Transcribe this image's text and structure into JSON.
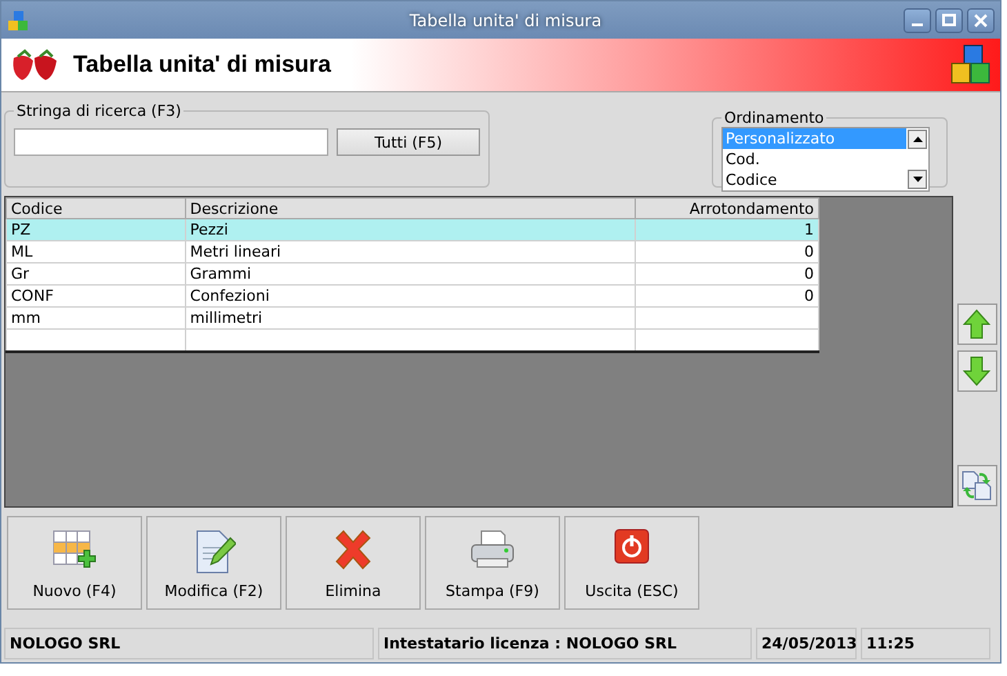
{
  "window": {
    "title": "Tabella unita' di misura"
  },
  "banner": {
    "title": "Tabella unita' di misura"
  },
  "search": {
    "label": "Stringa di ricerca (F3)",
    "button": "Tutti (F5)"
  },
  "ordering": {
    "label": "Ordinamento",
    "items": [
      {
        "label": "Personalizzato",
        "selected": true
      },
      {
        "label": "Cod.",
        "selected": false
      },
      {
        "label": "Codice",
        "selected": false
      }
    ]
  },
  "table": {
    "columns": [
      "Codice",
      "Descrizione",
      "Arrotondamento"
    ],
    "rows": [
      {
        "cells": [
          "PZ",
          "Pezzi",
          "1"
        ],
        "selected": true
      },
      {
        "cells": [
          "ML",
          "Metri lineari",
          "0"
        ],
        "selected": false
      },
      {
        "cells": [
          "Gr",
          "Grammi",
          "0"
        ],
        "selected": false
      },
      {
        "cells": [
          "CONF",
          "Confezioni",
          "0"
        ],
        "selected": false
      },
      {
        "cells": [
          "mm",
          "millimetri",
          ""
        ],
        "selected": false
      },
      {
        "cells": [
          "",
          "",
          ""
        ],
        "selected": false
      }
    ]
  },
  "side_buttons": [
    {
      "kind": "up"
    },
    {
      "kind": "down"
    },
    {
      "kind": "swap"
    }
  ],
  "toolbar": [
    {
      "kind": "new",
      "label": "Nuovo (F4)"
    },
    {
      "kind": "edit",
      "label": "Modifica (F2)"
    },
    {
      "kind": "delete",
      "label": "Elimina"
    },
    {
      "kind": "print",
      "label": "Stampa (F9)"
    },
    {
      "kind": "exit",
      "label": "Uscita (ESC)"
    }
  ],
  "status_bar": [
    "NOLOGO SRL",
    "Intestatario licenza : NOLOGO SRL",
    "24/05/2013",
    "11:25"
  ]
}
